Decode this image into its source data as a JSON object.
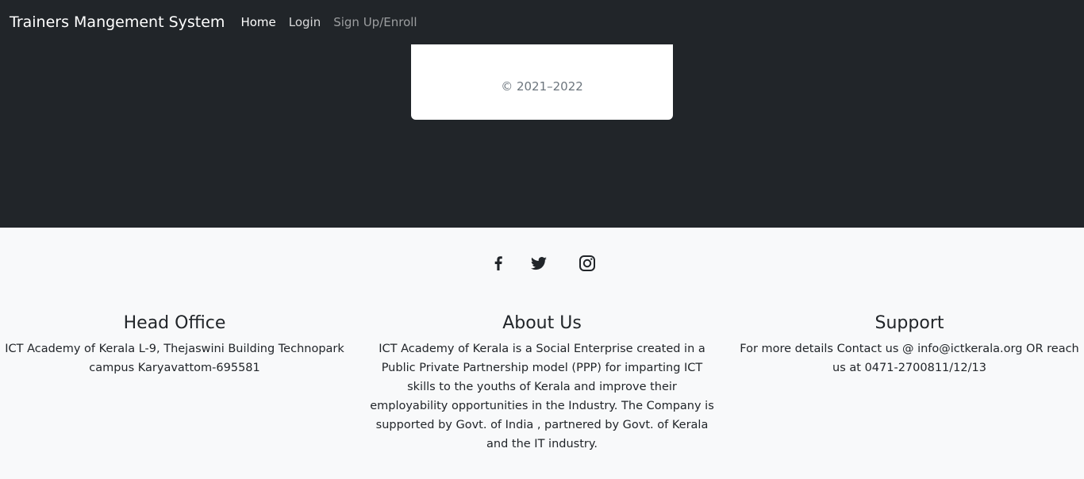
{
  "navbar": {
    "brand": "Trainers Mangement System",
    "links": [
      {
        "label": "Home",
        "state": "active"
      },
      {
        "label": "Login",
        "state": "normal"
      },
      {
        "label": "Sign Up/Enroll",
        "state": "muted"
      }
    ]
  },
  "card": {
    "copyright": "© 2021–2022"
  },
  "social": {
    "icons": [
      "facebook-icon",
      "twitter-icon",
      "instagram-icon"
    ]
  },
  "footer": {
    "head_office": {
      "title": "Head Office",
      "text": "ICT Academy of Kerala L-9, Thejaswini Building Technopark campus Karyavattom-695581"
    },
    "about_us": {
      "title": "About Us",
      "text": "ICT Academy of Kerala is a Social Enterprise created in a Public Private Partnership model (PPP) for imparting ICT skills to the youths of Kerala and improve their employability opportunities in the Industry. The Company is supported by Govt. of India , partnered by Govt. of Kerala and the IT industry."
    },
    "support": {
      "title": "Support",
      "text": "For more details Contact us @ info@ictkerala.org OR reach us at 0471-2700811/12/13"
    }
  },
  "colors": {
    "dark_bg": "#212529",
    "light_bg": "#f8f9fa",
    "card_bg": "#ffffff",
    "muted_text": "#6c757d"
  }
}
